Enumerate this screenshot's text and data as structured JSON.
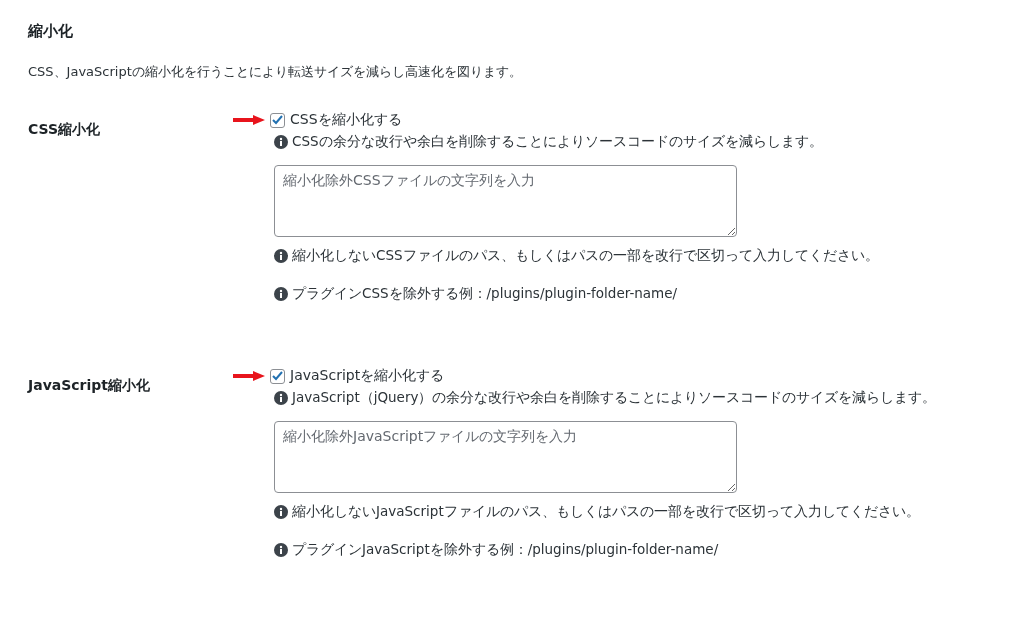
{
  "title": "縮小化",
  "description": "CSS、JavaScriptの縮小化を行うことにより転送サイズを減らし高速化を図ります。",
  "sections": [
    {
      "label": "CSS縮小化",
      "annotated": true,
      "checkbox": {
        "label": "CSSを縮小化する",
        "checked": true
      },
      "help": "CSSの余分な改行や余白を削除することによりソースコードのサイズを減らします。",
      "textarea": {
        "placeholder": "縮小化除外CSSファイルの文字列を入力"
      },
      "notes": [
        "縮小化しないCSSファイルのパス、もしくはパスの一部を改行で区切って入力してください。",
        "プラグインCSSを除外する例：/plugins/plugin-folder-name/"
      ]
    },
    {
      "label": "JavaScript縮小化",
      "annotated": true,
      "checkbox": {
        "label": "JavaScriptを縮小化する",
        "checked": true
      },
      "help": "JavaScript（jQuery）の余分な改行や余白を削除することによりソースコードのサイズを減らします。",
      "textarea": {
        "placeholder": "縮小化除外JavaScriptファイルの文字列を入力"
      },
      "notes": [
        "縮小化しないJavaScriptファイルのパス、もしくはパスの一部を改行で区切って入力してください。",
        "プラグインJavaScriptを除外する例：/plugins/plugin-folder-name/"
      ]
    }
  ]
}
